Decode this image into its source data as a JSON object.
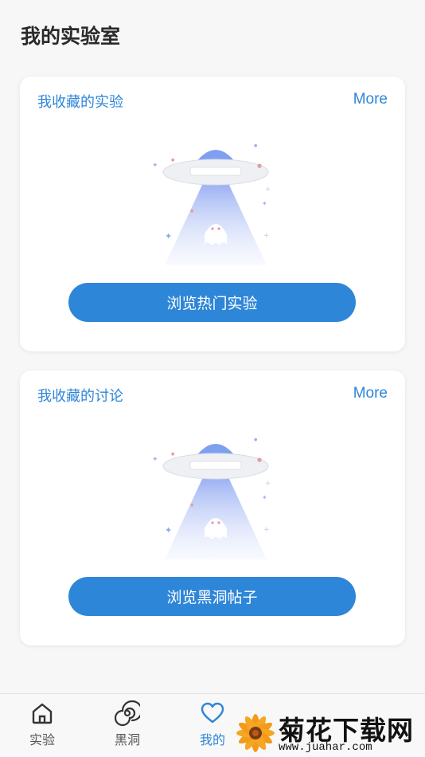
{
  "page": {
    "title": "我的实验室"
  },
  "cards": [
    {
      "title": "我收藏的实验",
      "more": "More",
      "button": "浏览热门实验"
    },
    {
      "title": "我收藏的讨论",
      "more": "More",
      "button": "浏览黑洞帖子"
    }
  ],
  "tabbar": {
    "tabs": [
      {
        "label": "实验",
        "icon": "home-icon",
        "active": false
      },
      {
        "label": "黑洞",
        "icon": "spiral-icon",
        "active": false
      },
      {
        "label": "我的",
        "icon": "heart-icon",
        "active": true
      }
    ]
  },
  "watermark": {
    "title": "菊花下载网",
    "url": "www.juahar.com"
  },
  "colors": {
    "accent": "#2e86d8",
    "background": "#f7f7f7",
    "card": "#ffffff"
  }
}
